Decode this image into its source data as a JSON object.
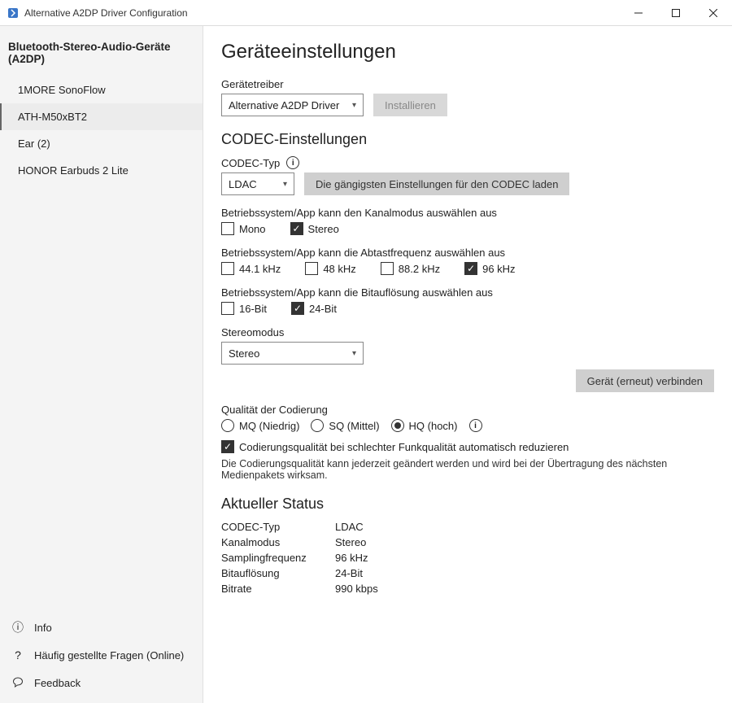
{
  "window": {
    "title": "Alternative A2DP Driver Configuration"
  },
  "sidebar": {
    "header": "Bluetooth-Stereo-Audio-Geräte (A2DP)",
    "items": [
      {
        "label": "1MORE SonoFlow"
      },
      {
        "label": "ATH-M50xBT2"
      },
      {
        "label": "Ear (2)"
      },
      {
        "label": "HONOR Earbuds 2 Lite"
      }
    ],
    "bottom": {
      "info": "Info",
      "faq": "Häufig gestellte Fragen (Online)",
      "feedback": "Feedback"
    }
  },
  "main": {
    "title": "Geräteeinstellungen",
    "driver": {
      "label": "Gerätetreiber",
      "value": "Alternative A2DP Driver",
      "install": "Installieren"
    },
    "codec": {
      "heading": "CODEC-Einstellungen",
      "type_label": "CODEC-Typ",
      "type_value": "LDAC",
      "load_defaults": "Die gängigsten Einstellungen für den CODEC laden",
      "channel_prompt": "Betriebssystem/App kann den Kanalmodus auswählen aus",
      "mono": "Mono",
      "stereo": "Stereo",
      "sample_prompt": "Betriebssystem/App kann die Abtastfrequenz auswählen aus",
      "sr_441": "44.1 kHz",
      "sr_48": "48 kHz",
      "sr_882": "88.2 kHz",
      "sr_96": "96 kHz",
      "bit_prompt": "Betriebssystem/App kann die Bitauflösung auswählen aus",
      "bit16": "16-Bit",
      "bit24": "24-Bit",
      "stereo_mode_label": "Stereomodus",
      "stereo_mode_value": "Stereo",
      "reconnect": "Gerät (erneut) verbinden",
      "quality_label": "Qualität der Codierung",
      "q_mq": "MQ (Niedrig)",
      "q_sq": "SQ (Mittel)",
      "q_hq": "HQ (hoch)",
      "auto_reduce": "Codierungsqualität bei schlechter Funkqualität automatisch reduzieren",
      "quality_hint": "Die Codierungsqualität kann jederzeit geändert werden und wird bei der Übertragung des nächsten Medienpakets wirksam."
    },
    "status": {
      "heading": "Aktueller Status",
      "codec_k": "CODEC-Typ",
      "codec_v": "LDAC",
      "chan_k": "Kanalmodus",
      "chan_v": "Stereo",
      "sr_k": "Samplingfrequenz",
      "sr_v": "96 kHz",
      "bit_k": "Bitauflösung",
      "bit_v": "24-Bit",
      "br_k": "Bitrate",
      "br_v": "990 kbps"
    }
  }
}
